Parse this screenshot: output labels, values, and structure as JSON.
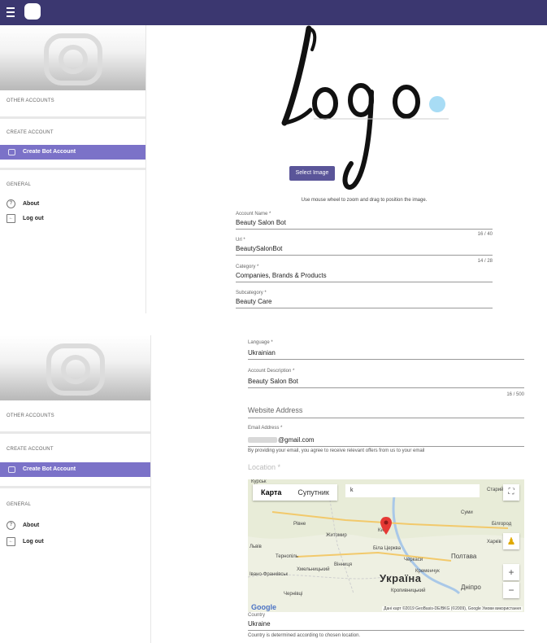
{
  "topbar": {
    "menu_icon": "hamburger-icon",
    "app_icon": "app-logo"
  },
  "sidebar": {
    "other_accounts": "OTHER ACCOUNTS",
    "create_account": "CREATE ACCOUNT",
    "create_bot": "Create Bot Account",
    "general": "GENERAL",
    "about": "About",
    "logout": "Log out"
  },
  "logo": {
    "text": "Logo",
    "accent_color": "#a8dcf5"
  },
  "select_image_label": "Select Image",
  "image_hint": "Use mouse wheel to zoom and drag to position the image.",
  "form1": {
    "account_name_label": "Account Name *",
    "account_name_value": "Beauty Salon Bot",
    "account_name_counter": "16 / 40",
    "url_label": "Url *",
    "url_value": "BeautySalonBot",
    "url_counter": "14 / 28",
    "category_label": "Category *",
    "category_value": "Companies, Brands & Products",
    "subcategory_label": "Subcategory *",
    "subcategory_value": "Beauty Care"
  },
  "form2": {
    "language_label": "Language *",
    "language_value": "Ukrainian",
    "description_label": "Account Description *",
    "description_value": "Beauty Salon Bot",
    "description_counter": "16 / 500",
    "website_placeholder": "Website Address",
    "email_label": "Email Address *",
    "email_value": "@gmail.com",
    "email_note": "By providing your email, you agree to receive relevant offers from us to your email",
    "location_label": "Location *",
    "country_label": "Country",
    "country_value": "Ukraine",
    "country_note": "Country is determined according to chosen location."
  },
  "map": {
    "tab_map": "Карта",
    "tab_satellite": "Супутник",
    "search_value": "k",
    "country_name": "Україна",
    "places": [
      "Рівне",
      "Житомир",
      "Київ",
      "Суми",
      "Харків",
      "Львів",
      "Тернопіль",
      "Біла Церква",
      "Черкаси",
      "Полтава",
      "Хмельницький",
      "Вінниця",
      "Кременчук",
      "Івано-Франківськ",
      "Кропивницький",
      "Дніпро",
      "Чернівці",
      "Білгород",
      "Курськ",
      "Старий"
    ],
    "attribution": "Дані карт ©2019 GeoBasis-DE/BKG (©2009), Google   Умови використання",
    "google": "Google",
    "zoom_in": "+",
    "zoom_out": "−",
    "accent": "#e53935"
  }
}
